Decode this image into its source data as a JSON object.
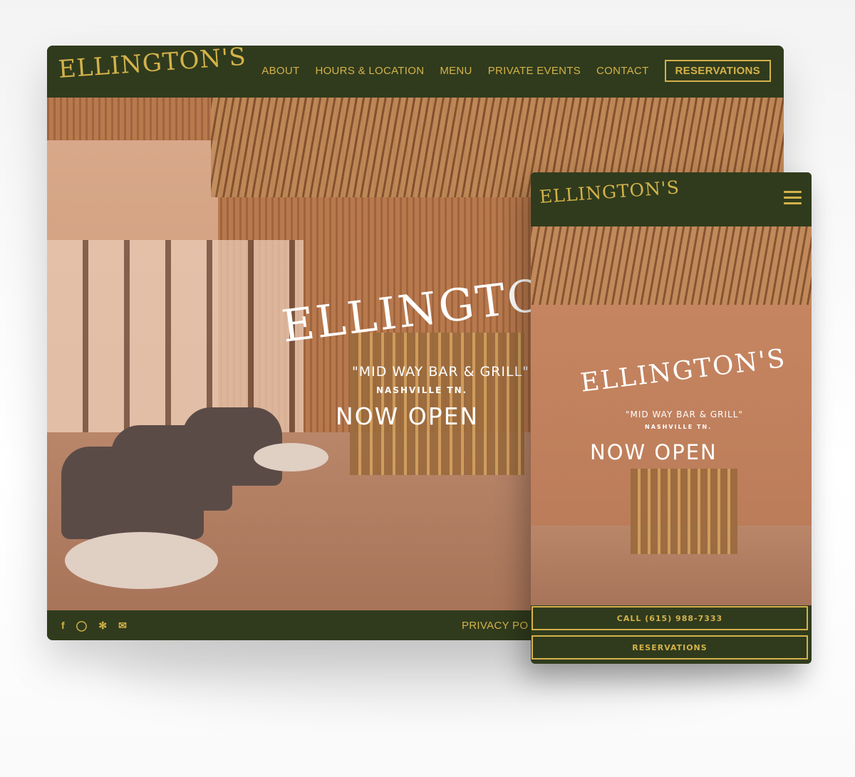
{
  "brand": {
    "logo_text": "ELLINGTON'S"
  },
  "desktop": {
    "nav": {
      "items": [
        "ABOUT",
        "HOURS & LOCATION",
        "MENU",
        "PRIVATE EVENTS",
        "CONTACT"
      ],
      "reservations_label": "RESERVATIONS"
    },
    "hero": {
      "logo": "ELLINGTON'S",
      "tagline": "\"MID WAY BAR & GRILL\"",
      "city": "NASHVILLE TN.",
      "headline": "NOW OPEN"
    },
    "footer": {
      "social_icons": [
        "facebook-icon",
        "instagram-icon",
        "yelp-icon",
        "email-icon"
      ],
      "privacy_text": "PRIVACY PO"
    }
  },
  "mobile": {
    "logo": "ELLINGTON'S",
    "hero": {
      "logo": "ELLINGTON'S",
      "tagline": "\"MID WAY BAR & GRILL\"",
      "city": "NASHVILLE TN.",
      "headline": "NOW OPEN"
    },
    "call_button": "CALL (615) 988-7333",
    "reservations_button": "RESERVATIONS"
  },
  "colors": {
    "brand_green": "#303b1d",
    "brand_gold": "#d4b24a"
  }
}
